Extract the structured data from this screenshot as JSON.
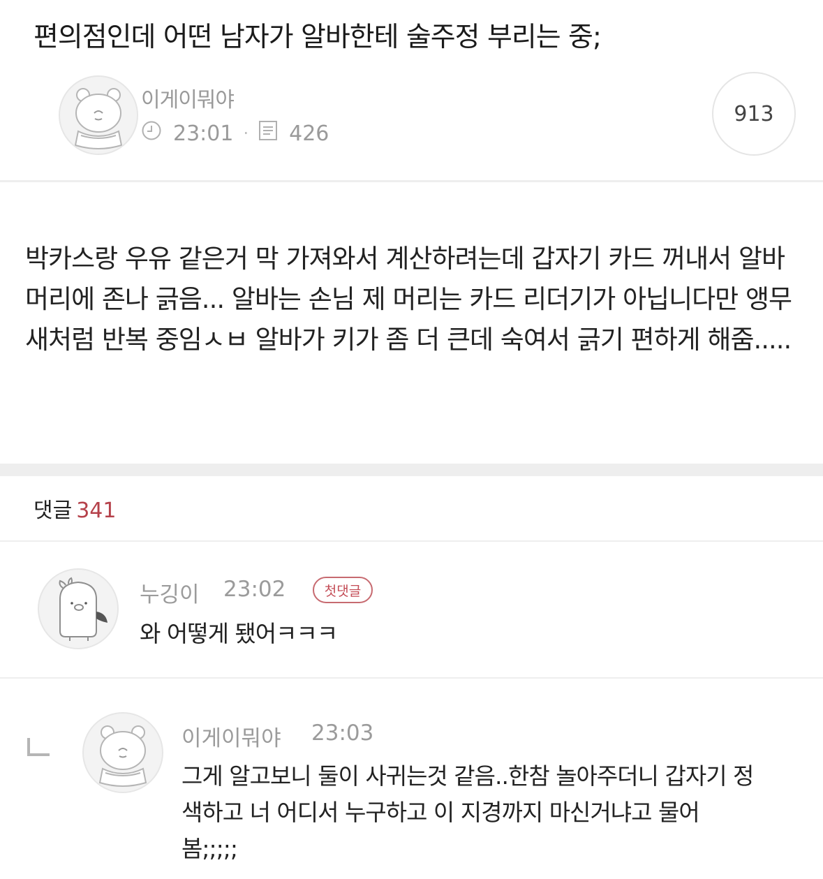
{
  "post": {
    "title": "편의점인데 어떤 남자가 알바한테 술주정 부리는 중;",
    "author": "이게이뭐야",
    "time": "23:01",
    "count": "426",
    "views": "913",
    "body": "박카스랑 우유 같은거 막 가져와서 계산하려는데 갑자기 카드 꺼내서 알바 머리에 존나 긁음... 알바는 손님 제 머리는 카드 리더기가 아닙니다만 앵무새처럼 반복 중임ㅅㅂ 알바가 키가 좀 더 큰데 숙여서 긁기 편하게 해줌....."
  },
  "comments_header": {
    "label": "댓글",
    "count": "341"
  },
  "comments": [
    {
      "author": "누깅이",
      "time": "23:02",
      "badge": "첫댓글",
      "text": "와 어떻게 됐어ㅋㅋㅋ",
      "avatar_icon": "penguin-avatar-icon"
    },
    {
      "author": "이게이뭐야",
      "time": "23:03",
      "text": "그게 알고보니 둘이 사귀는것 같음..한참 놀아주더니 갑자기 정색하고 너 어디서 누구하고 이 지경까지 마신거냐고 물어봄;;;;;",
      "avatar_icon": "bear-avatar-icon",
      "is_reply": true
    }
  ],
  "icons": {
    "clock": "clock-icon",
    "document": "document-icon",
    "reply": "reply-arrow-icon"
  },
  "colors": {
    "accent": "#b5414a",
    "muted_text": "#9a9a9a",
    "divider": "#eeeeee"
  }
}
